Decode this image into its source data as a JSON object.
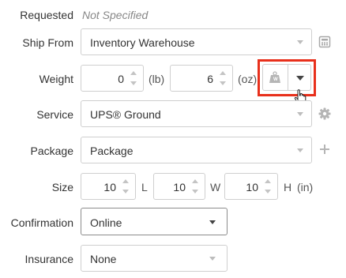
{
  "requested": {
    "label": "Requested",
    "value": "Not Specified"
  },
  "ship_from": {
    "label": "Ship From",
    "value": "Inventory Warehouse",
    "icon": "calculator-icon"
  },
  "weight": {
    "label": "Weight",
    "lb_value": "0",
    "lb_unit": "(lb)",
    "oz_value": "6",
    "oz_unit": "(oz)",
    "scale_icon": "scale-weight-icon",
    "scale_icon_letter": "W",
    "dropdown_icon": "caret-down-icon",
    "highlight_color": "#e8301c"
  },
  "service": {
    "label": "Service",
    "value": "UPS® Ground",
    "icon": "gear-icon"
  },
  "package": {
    "label": "Package",
    "value": "Package",
    "icon": "plus-icon"
  },
  "size": {
    "label": "Size",
    "length": "10",
    "length_unit": "L",
    "width": "10",
    "width_unit": "W",
    "height": "10",
    "height_unit": "H",
    "units": "(in)"
  },
  "confirmation": {
    "label": "Confirmation",
    "value": "Online"
  },
  "insurance": {
    "label": "Insurance",
    "value": "None"
  }
}
